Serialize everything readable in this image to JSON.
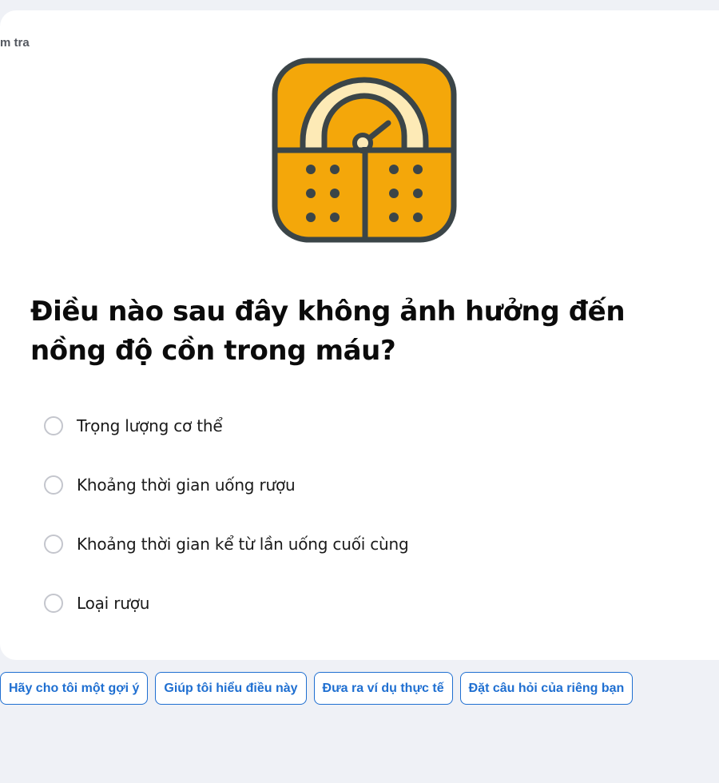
{
  "card": {
    "label": "m tra"
  },
  "illustration": {
    "icon": "weighing-scale-icon"
  },
  "question": {
    "text": "Điều nào sau đây không ảnh hưởng đến nồng độ cồn trong máu?"
  },
  "options": [
    {
      "label": "Trọng lượng cơ thể",
      "selected": false
    },
    {
      "label": "Khoảng thời gian uống rượu",
      "selected": false
    },
    {
      "label": "Khoảng thời gian kể từ lần uống cuối cùng",
      "selected": false
    },
    {
      "label": "Loại rượu",
      "selected": false
    }
  ],
  "suggestions": [
    {
      "label": "Hãy cho tôi một gợi ý"
    },
    {
      "label": "Giúp tôi hiểu điều này"
    },
    {
      "label": "Đưa ra ví dụ thực tế"
    },
    {
      "label": "Đặt câu hỏi của riêng bạn"
    }
  ],
  "colors": {
    "accent": "#1f6fd1",
    "background": "#eff1f6",
    "illustration_yellow": "#f4a70a",
    "illustration_cream": "#fdeab6",
    "illustration_outline": "#3b4548"
  }
}
